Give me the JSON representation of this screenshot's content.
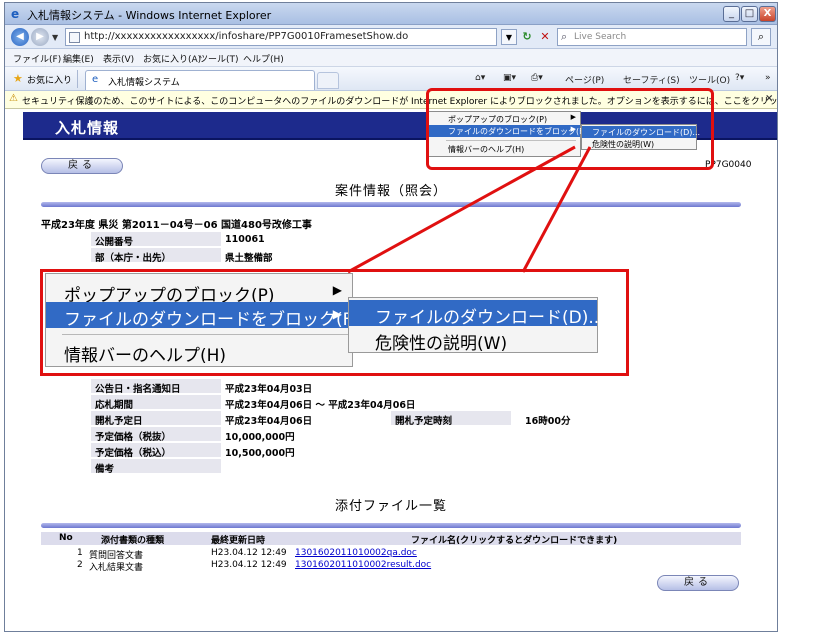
{
  "window": {
    "title": "入札情報システム - Windows Internet Explorer",
    "controls": {
      "minimize": "_",
      "maximize": "□",
      "close": "X"
    }
  },
  "address_bar": {
    "url": "http://xxxxxxxxxxxxxxxxx/infoshare/PP7G0010FramesetShow.do",
    "search_placeholder": "Live Search"
  },
  "menu_bar": {
    "items": [
      "ファイル(F)",
      "編集(E)",
      "表示(V)",
      "お気に入り(A)",
      "ツール(T)",
      "ヘルプ(H)"
    ]
  },
  "favorites_bar": {
    "favorites_label": "お気に入り",
    "tab_title": "入札情報システム",
    "commands": {
      "page": "ページ(P)",
      "safety": "セーフティ(S)",
      "tools": "ツール(O)",
      "more": "»"
    }
  },
  "info_bar": {
    "message": "セキュリティ保護のため、このサイトによる、このコンピュータへのファイルのダウンロードが Internet Explorer によりブロックされました。オプションを表示するには、ここをクリックしてください...",
    "close": "×"
  },
  "page": {
    "banner_title": "入札情報",
    "back_label": "戻る",
    "screen_code": "PP7G0040",
    "case_title": "案件情報（照会）",
    "project_name": "平成23年度 県災 第2011－04号－06 国道480号改修工事",
    "fields_top": [
      {
        "label": "公開番号",
        "value": "110061"
      },
      {
        "label": "部（本庁・出先）",
        "value": "県土整備部"
      }
    ],
    "fields_bottom": [
      {
        "label": "公告日・指名通知日",
        "value": "平成23年04月03日"
      },
      {
        "label": "応札期間",
        "value": "平成23年04月06日 ～ 平成23年04月06日"
      },
      {
        "label": "開札予定日",
        "value": "平成23年04月06日",
        "extra_label": "開札予定時刻",
        "extra_value": "16時00分"
      },
      {
        "label": "予定価格（税抜）",
        "value": "10,000,000円"
      },
      {
        "label": "予定価格（税込）",
        "value": "10,500,000円"
      },
      {
        "label": "備考",
        "value": ""
      }
    ],
    "attach_title": "添付ファイル一覧",
    "attach_headers": [
      "No",
      "添付書類の種類",
      "最終更新日時",
      "ファイル名(クリックするとダウンロードできます)"
    ],
    "attach_rows": [
      {
        "no": "1",
        "type": "質問回答文書",
        "updated": "H23.04.12 12:49",
        "file": "1301602011010002qa.doc"
      },
      {
        "no": "2",
        "type": "入札結果文書",
        "updated": "H23.04.12 12:49",
        "file": "1301602011010002result.doc"
      }
    ]
  },
  "context_menu": {
    "popup_block": "ポップアップのブロック(P)",
    "file_download_block": "ファイルのダウンロードをブロック(F)",
    "info_bar_help": "情報バーのヘルプ(H)",
    "sub_download": "ファイルのダウンロード(D)...",
    "sub_risk": "危険性の説明(W)"
  },
  "colors": {
    "banner": "#1d2a8c",
    "highlight": "#316ac5",
    "callout_red": "#e01010",
    "info_bar": "#ffffe1"
  }
}
